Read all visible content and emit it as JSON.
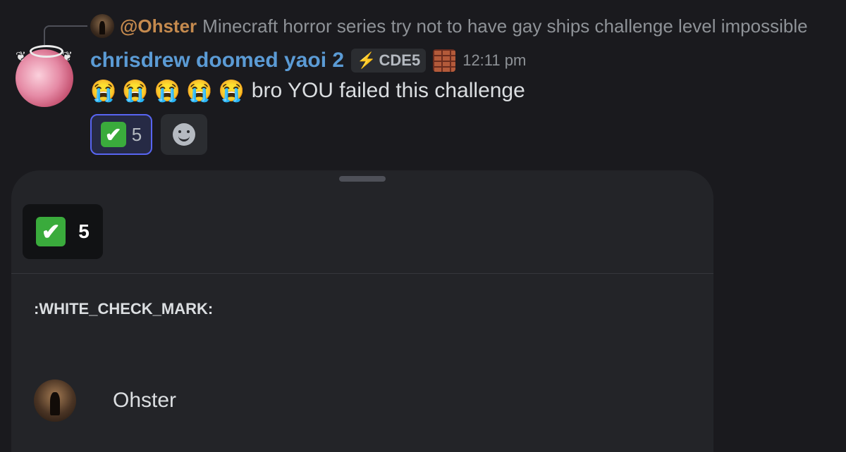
{
  "reply": {
    "username": "@Ohster",
    "text": "Minecraft horror series try not to have gay ships challenge level impossible"
  },
  "author": {
    "username": "chrisdrew doomed yaoi 2",
    "tag": "CDE5",
    "tag_icon": "lightning-icon",
    "badge_icon": "brick-icon",
    "timestamp": "12:11 pm"
  },
  "message": {
    "emojis": [
      "😭",
      "😭",
      "😭",
      "😭",
      "😭"
    ],
    "text": "bro YOU failed this challenge"
  },
  "reactions": [
    {
      "emoji": "✔",
      "count": "5"
    }
  ],
  "sheet": {
    "tab": {
      "emoji": "✔",
      "count": "5"
    },
    "emoji_name": ":WHITE_CHECK_MARK:",
    "users": [
      {
        "name": "Ohster"
      }
    ]
  },
  "colors": {
    "background": "#1a1a1e",
    "sheet": "#232428",
    "username": "#5b9bd5",
    "reply_user": "#c58a4e",
    "reaction_border": "#5865f2",
    "check_green": "#3aab3c"
  }
}
